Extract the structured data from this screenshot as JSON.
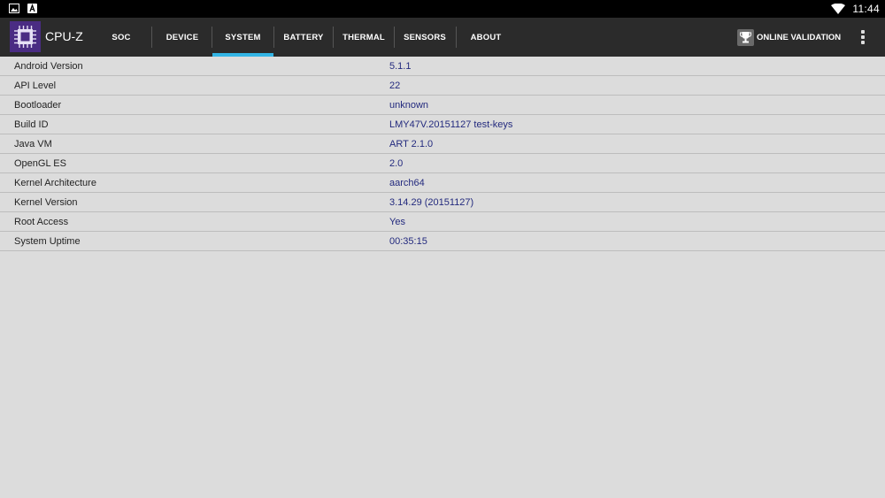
{
  "status_bar": {
    "time": "11:44",
    "icons": [
      "gallery-icon",
      "app-icon",
      "wifi-icon"
    ]
  },
  "app_bar": {
    "title": "CPU-Z",
    "tabs": [
      {
        "label": "SOC",
        "active": false
      },
      {
        "label": "DEVICE",
        "active": false
      },
      {
        "label": "SYSTEM",
        "active": true
      },
      {
        "label": "BATTERY",
        "active": false
      },
      {
        "label": "THERMAL",
        "active": false
      },
      {
        "label": "SENSORS",
        "active": false
      },
      {
        "label": "ABOUT",
        "active": false
      }
    ],
    "validation_label": "ONLINE VALIDATION",
    "accent_color": "#33b5e5"
  },
  "system_info": [
    {
      "key": "Android Version",
      "value": "5.1.1"
    },
    {
      "key": "API Level",
      "value": "22"
    },
    {
      "key": "Bootloader",
      "value": "unknown"
    },
    {
      "key": "Build ID",
      "value": "LMY47V.20151127 test-keys"
    },
    {
      "key": "Java VM",
      "value": "ART 2.1.0"
    },
    {
      "key": "OpenGL ES",
      "value": "2.0"
    },
    {
      "key": "Kernel Architecture",
      "value": "aarch64"
    },
    {
      "key": "Kernel Version",
      "value": "3.14.29 (20151127)"
    },
    {
      "key": "Root Access",
      "value": "Yes"
    },
    {
      "key": "System Uptime",
      "value": "00:35:15"
    }
  ]
}
